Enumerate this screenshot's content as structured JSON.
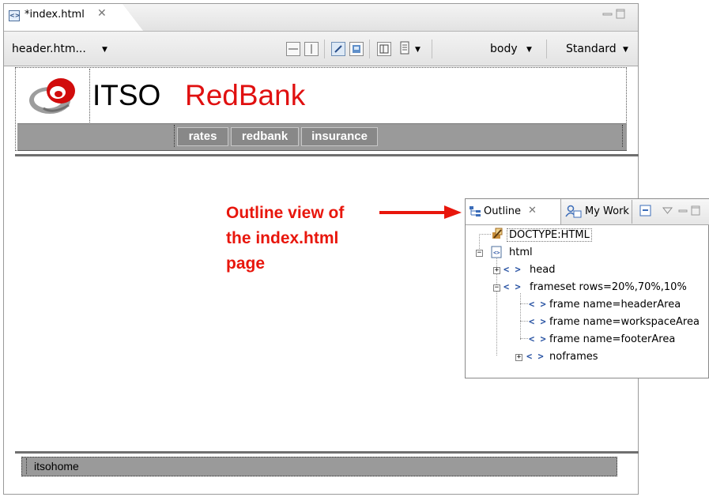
{
  "editor": {
    "tab_title": "*index.html",
    "tab_close_glyph": "✕",
    "toolbar": {
      "frame_selector": "header.htm...",
      "element_selector": "body",
      "view_mode": "Standard"
    }
  },
  "page": {
    "title_prefix": "ITSO",
    "title_brand": "RedBank",
    "nav_links": [
      "rates",
      "redbank",
      "insurance"
    ],
    "footer_link": "itsohome"
  },
  "callout": {
    "line1": "Outline view of",
    "line2": "the index.html",
    "line3": "page",
    "color": "#e8160c"
  },
  "outline_view": {
    "tab_outline": "Outline",
    "tab_outline_close": "✕",
    "tab_mywork": "My Work",
    "tree": {
      "doctype": "DOCTYPE:HTML",
      "html": "html",
      "head": "head",
      "frameset": "frameset rows=20%,70%,10%",
      "frame_header": "frame name=headerArea",
      "frame_workspace": "frame name=workspaceArea",
      "frame_footer": "frame name=footerArea",
      "noframes": "noframes"
    }
  },
  "colors": {
    "brand_red": "#e01010",
    "nav_gray": "#9a9a9a"
  },
  "icons": [
    "html-file-icon",
    "close-icon",
    "minimize-icon",
    "maximize-icon",
    "caret-down-icon",
    "outline-icon",
    "my-work-icon",
    "doctype-icon",
    "tag-icon",
    "collapse-all-icon",
    "view-menu-icon"
  ]
}
